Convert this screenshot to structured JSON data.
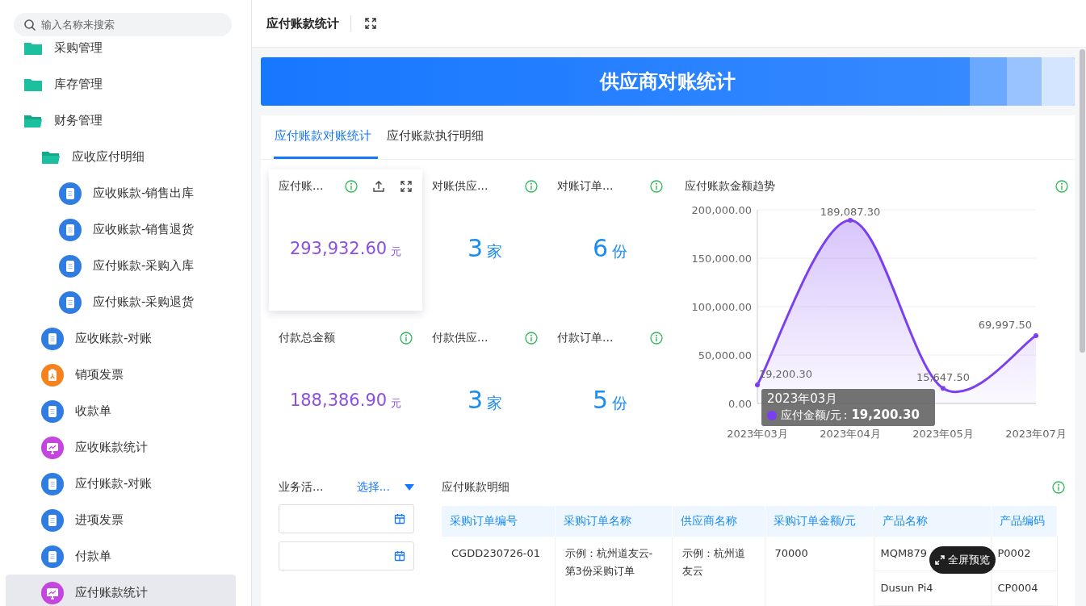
{
  "sidebar": {
    "search": {
      "placeholder": "输入名称来搜索"
    },
    "items": [
      {
        "label": "采购管理",
        "kind": "folder",
        "expanded": false,
        "selected": false
      },
      {
        "label": "库存管理",
        "kind": "folder",
        "expanded": false,
        "selected": false
      },
      {
        "label": "财务管理",
        "kind": "folder",
        "expanded": true,
        "selected": false,
        "children": [
          {
            "label": "应收应付明细",
            "kind": "folder",
            "expanded": true,
            "selected": false,
            "children": [
              {
                "label": "应收账款-销售出库",
                "kind": "doc",
                "selected": false
              },
              {
                "label": "应收账款-销售退货",
                "kind": "doc",
                "selected": false
              },
              {
                "label": "应付账款-采购入库",
                "kind": "doc",
                "selected": false
              },
              {
                "label": "应付账款-采购退货",
                "kind": "doc",
                "selected": false
              }
            ]
          },
          {
            "label": "应收账款-对账",
            "kind": "doc",
            "selected": false
          },
          {
            "label": "销项发票",
            "kind": "invoice",
            "selected": false
          },
          {
            "label": "收款单",
            "kind": "doc",
            "selected": false
          },
          {
            "label": "应收账款统计",
            "kind": "chart",
            "selected": false
          },
          {
            "label": "应付账款-对账",
            "kind": "doc",
            "selected": false
          },
          {
            "label": "进项发票",
            "kind": "doc",
            "selected": false
          },
          {
            "label": "付款单",
            "kind": "doc",
            "selected": false
          },
          {
            "label": "应付账款统计",
            "kind": "chart",
            "selected": true
          }
        ]
      }
    ]
  },
  "header": {
    "title": "应付账款统计"
  },
  "banner": {
    "title": "供应商对账统计"
  },
  "tabs": [
    {
      "label": "应付账款对账统计",
      "selected": true
    },
    {
      "label": "应付账款执行明细",
      "selected": false
    }
  ],
  "stats": [
    {
      "title": "应付账...",
      "value": "293,932.60",
      "unit": "元",
      "kind": "amount",
      "active": true
    },
    {
      "title": "对账供应...",
      "value": "3",
      "unit": "家",
      "kind": "count",
      "active": false
    },
    {
      "title": "对账订单...",
      "value": "6",
      "unit": "份",
      "kind": "count",
      "active": false
    },
    {
      "title": "付款总金额",
      "value": "188,386.90",
      "unit": "元",
      "kind": "amount",
      "active": false
    },
    {
      "title": "付款供应...",
      "value": "3",
      "unit": "家",
      "kind": "count",
      "active": false
    },
    {
      "title": "付款订单...",
      "value": "5",
      "unit": "份",
      "kind": "count",
      "active": false
    }
  ],
  "trend": {
    "title": "应付账款金额趋势",
    "chart_data": {
      "type": "area",
      "categories": [
        "2023年03月",
        "2023年04月",
        "2023年05月",
        "2023年07月"
      ],
      "series": [
        {
          "name": "应付金额/元",
          "color": "#7b3ff2",
          "values": [
            19200.3,
            189087.3,
            15647.5,
            69997.5
          ]
        }
      ],
      "ylim": [
        0,
        200000
      ],
      "grid": true,
      "yticks": [
        {
          "value": 0,
          "label": "0.00"
        },
        {
          "value": 50000,
          "label": "50,000.00"
        },
        {
          "value": 100000,
          "label": "100,000.00"
        },
        {
          "value": 150000,
          "label": "150,000.00"
        },
        {
          "value": 200000,
          "label": "200,000.00"
        }
      ],
      "value_labels": [
        "19,200.30",
        "189,087.30",
        "15,647.50",
        "69,997.50"
      ]
    },
    "tooltip": {
      "title": "2023年03月",
      "separator": ":",
      "value": "19,200.30"
    }
  },
  "filter": {
    "label": "业务活...",
    "select": "选择..."
  },
  "detail": {
    "title": "应付账款明细",
    "columns": [
      "采购订单编号",
      "采购订单名称",
      "供应商名称",
      "采购订单金额/元",
      "产品名称",
      "产品编码"
    ],
    "rows": [
      {
        "order_no": "CGDD230726-01",
        "order_name": "示例：杭州道友云-第3份采购订单",
        "supplier": "示例：杭州道友云",
        "amount": "70000",
        "products": [
          {
            "name": "MQM879",
            "code": "P0002"
          },
          {
            "name": "Dusun Pi4",
            "code": "CP0004"
          }
        ]
      }
    ]
  },
  "fullscreen_button": "全屏预览"
}
